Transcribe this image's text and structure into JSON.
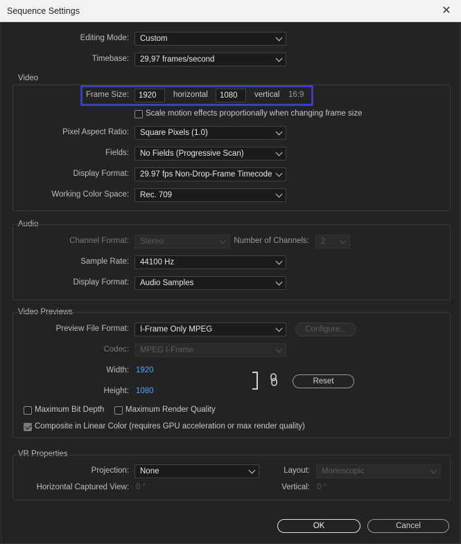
{
  "window": {
    "title": "Sequence Settings",
    "close_glyph": "✕"
  },
  "general": {
    "editing_mode": {
      "label": "Editing Mode:",
      "value": "Custom"
    },
    "timebase": {
      "label": "Timebase:",
      "value": "29,97  frames/second"
    }
  },
  "video": {
    "title": "Video",
    "frame_size": {
      "label": "Frame Size:",
      "width": "1920",
      "horizontal_label": "horizontal",
      "height": "1080",
      "vertical_label": "vertical",
      "aspect": "16:9"
    },
    "scale_motion": {
      "label": "Scale motion effects proportionally when changing frame size",
      "checked": false
    },
    "pixel_aspect": {
      "label": "Pixel Aspect Ratio:",
      "value": "Square Pixels (1.0)"
    },
    "fields": {
      "label": "Fields:",
      "value": "No Fields (Progressive Scan)"
    },
    "display_format": {
      "label": "Display Format:",
      "value": "29.97 fps Non-Drop-Frame Timecode"
    },
    "color_space": {
      "label": "Working Color Space:",
      "value": "Rec. 709"
    }
  },
  "audio": {
    "title": "Audio",
    "channel_format": {
      "label": "Channel Format:",
      "value": "Stereo"
    },
    "num_channels": {
      "label": "Number of Channels:",
      "value": "2"
    },
    "sample_rate": {
      "label": "Sample Rate:",
      "value": "44100 Hz"
    },
    "display_format": {
      "label": "Display Format:",
      "value": "Audio Samples"
    }
  },
  "previews": {
    "title": "Video Previews",
    "file_format": {
      "label": "Preview File Format:",
      "value": "I-Frame Only MPEG"
    },
    "configure_label": "Configure...",
    "codec": {
      "label": "Codec:",
      "value": "MPEG I-Frame"
    },
    "width": {
      "label": "Width:",
      "value": "1920"
    },
    "height": {
      "label": "Height:",
      "value": "1080"
    },
    "reset_label": "Reset",
    "max_bit_depth": {
      "label": "Maximum Bit Depth",
      "checked": false
    },
    "max_render_quality": {
      "label": "Maximum Render Quality",
      "checked": false
    },
    "composite_linear": {
      "label": "Composite in Linear Color (requires GPU acceleration or max render quality)",
      "checked": true
    }
  },
  "vr": {
    "title": "VR Properties",
    "projection": {
      "label": "Projection:",
      "value": "None"
    },
    "layout": {
      "label": "Layout:",
      "value": "Monoscopic"
    },
    "horizontal_view": {
      "label": "Horizontal Captured View:",
      "value": "0 °"
    },
    "vertical": {
      "label": "Vertical:",
      "value": "0 °"
    }
  },
  "footer": {
    "ok_label": "OK",
    "cancel_label": "Cancel"
  },
  "colors": {
    "highlight": "#3b3fbd",
    "link_blue": "#4ea3ff",
    "background": "#232323"
  }
}
